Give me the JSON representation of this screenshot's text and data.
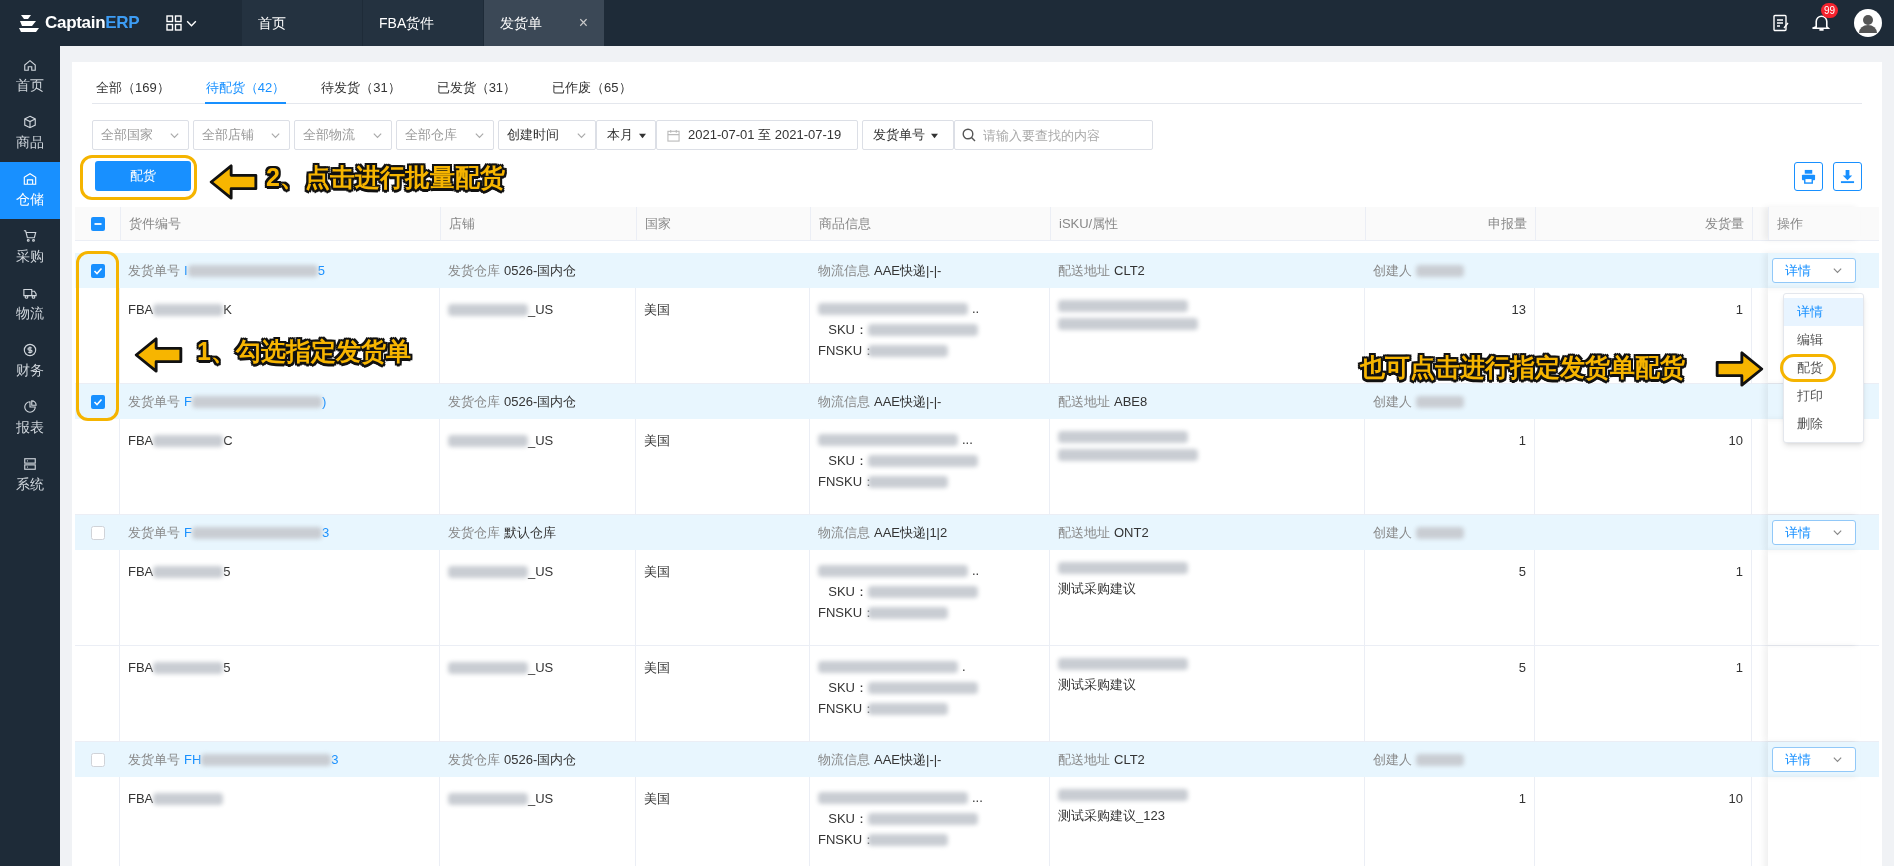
{
  "app": {
    "logo_main": "Captain",
    "logo_accent": "ERP"
  },
  "top_tabs": [
    {
      "label": "首页",
      "selected": false
    },
    {
      "label": "FBA货件",
      "selected": false
    },
    {
      "label": "发货单",
      "selected": true,
      "close": "×"
    }
  ],
  "notifications": {
    "badge": "99"
  },
  "sidebar": [
    {
      "label": "首页",
      "selected": false
    },
    {
      "label": "商品",
      "selected": false
    },
    {
      "label": "仓储",
      "selected": true
    },
    {
      "label": "采购",
      "selected": false
    },
    {
      "label": "物流",
      "selected": false
    },
    {
      "label": "财务",
      "selected": false
    },
    {
      "label": "报表",
      "selected": false
    },
    {
      "label": "系统",
      "selected": false
    }
  ],
  "status_tabs": [
    {
      "label": "全部（169）",
      "selected": false
    },
    {
      "label": "待配货（42）",
      "selected": true
    },
    {
      "label": "待发货（31）",
      "selected": false
    },
    {
      "label": "已发货（31）",
      "selected": false
    },
    {
      "label": "已作废（65）",
      "selected": false
    }
  ],
  "filters": [
    {
      "kind": "select",
      "placeholder": "全部国家"
    },
    {
      "kind": "select",
      "placeholder": "全部店铺"
    },
    {
      "kind": "select",
      "placeholder": "全部物流"
    },
    {
      "kind": "select",
      "placeholder": "全部仓库"
    },
    {
      "kind": "select",
      "value": "创建时间"
    },
    {
      "kind": "menu",
      "value": "本月"
    },
    {
      "kind": "date_range",
      "value": "2021-07-01 至 2021-07-19"
    },
    {
      "kind": "menu",
      "value": "发货单号"
    },
    {
      "kind": "search",
      "placeholder": "请输入要查找的内容"
    }
  ],
  "allocate_button": "配货",
  "table": {
    "header_indeterminate": true,
    "columns": [
      "货件编号",
      "店铺",
      "国家",
      "商品信息",
      "iSKU/属性",
      "申报量",
      "发货量",
      "操作"
    ],
    "groups": [
      {
        "checked": true,
        "number_label": "发货单号",
        "number_start": "I",
        "number_end": "5",
        "warehouse_label": "发货仓库",
        "warehouse": "0526-国内仓",
        "logistics_label": "物流信息",
        "logistics": "AAE快递|-|-",
        "address_label": "配送地址",
        "address": "CLT2",
        "creator_label": "创建人",
        "action": "详情",
        "items": [
          {
            "shipment_start": "FBA",
            "shipment_end": "K",
            "store_suffix": "_US",
            "country": "美国",
            "product_end": "..",
            "sku_label": "SKU：",
            "fnsku_label": "FNSKU：",
            "declared": "13",
            "shipped": "1"
          }
        ]
      },
      {
        "checked": true,
        "number_label": "发货单号",
        "number_start": "F",
        "number_end": ")",
        "warehouse_label": "发货仓库",
        "warehouse": "0526-国内仓",
        "logistics_label": "物流信息",
        "logistics": "AAE快递|-|-",
        "address_label": "配送地址",
        "address": "ABE8",
        "creator_label": "创建人",
        "items": [
          {
            "shipment_start": "FBA",
            "shipment_end": "C",
            "store_suffix": "_US",
            "country": "美国",
            "product_end": "...",
            "sku_label": "SKU：",
            "fnsku_label": "FNSKU：",
            "declared": "1",
            "shipped": "10"
          }
        ]
      },
      {
        "checked": false,
        "number_label": "发货单号",
        "number_start": "F",
        "number_end": "3",
        "warehouse_label": "发货仓库",
        "warehouse": "默认仓库",
        "logistics_label": "物流信息",
        "logistics": "AAE快递|1|2",
        "address_label": "配送地址",
        "address": "ONT2",
        "creator_label": "创建人",
        "action": "详情",
        "items": [
          {
            "shipment_start": "FBA",
            "shipment_end": "5",
            "store_suffix": "_US",
            "country": "美国",
            "product_end": "..",
            "sku_label": "SKU：",
            "fnsku_label": "FNSKU：",
            "isku_note": "测试采购建议",
            "declared": "5",
            "shipped": "1"
          },
          {
            "shipment_start": "FBA",
            "shipment_end": "5",
            "store_suffix": "_US",
            "country": "美国",
            "product_end": ".",
            "sku_label": "SKU：",
            "fnsku_label": "FNSKU：",
            "isku_note": "测试采购建议",
            "declared": "5",
            "shipped": "1"
          }
        ]
      },
      {
        "checked": false,
        "number_label": "发货单号",
        "number_start": "FH",
        "number_end": "3",
        "warehouse_label": "发货仓库",
        "warehouse": "0526-国内仓",
        "logistics_label": "物流信息",
        "logistics": "AAE快递|-|-",
        "address_label": "配送地址",
        "address": "CLT2",
        "creator_label": "创建人",
        "action": "详情",
        "items": [
          {
            "shipment_start": "FBA",
            "store_suffix": "_US",
            "country": "美国",
            "product_end": "...",
            "sku_label": "SKU：",
            "fnsku_label": "FNSKU：",
            "isku_note": "测试采购建议_123",
            "declared": "1",
            "shipped": "10"
          }
        ]
      }
    ]
  },
  "action_menu": [
    {
      "label": "详情",
      "selected": true
    },
    {
      "label": "编辑",
      "selected": false
    },
    {
      "label": "配货",
      "selected": false
    },
    {
      "label": "打印",
      "selected": false
    },
    {
      "label": "删除",
      "selected": false
    }
  ],
  "annotations": [
    {
      "kind": "left_arrow",
      "text": "1、勾选指定发货单"
    },
    {
      "kind": "left_arrow",
      "text": "2、点击进行批量配货"
    },
    {
      "kind": "right_arrow",
      "text": "也可点击进行指定发货单配货"
    }
  ]
}
